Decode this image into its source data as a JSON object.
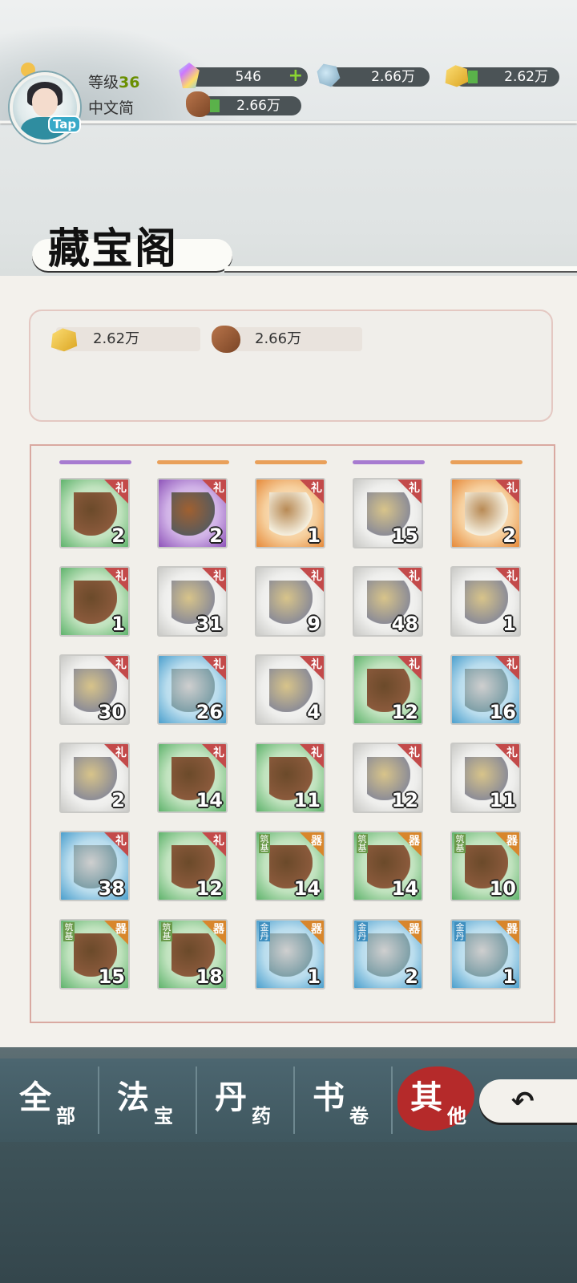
{
  "header": {
    "level_label": "等级",
    "level_value": "36",
    "language": "中文简",
    "avatar_badge": "Tap",
    "resources": {
      "spirit_gem": {
        "value": "546",
        "icon": "rainbow-gem-icon",
        "plus": "+"
      },
      "ore": {
        "value": "2.66万",
        "icon": "blue-ore-icon"
      },
      "gold": {
        "value": "2.62万",
        "icon": "gold-ore-icon"
      },
      "wood": {
        "value": "2.66万",
        "icon": "wood-log-icon"
      }
    }
  },
  "title": "藏宝阁",
  "currency_panel": {
    "gold": {
      "value": "2.62万",
      "icon": "gold-ore-icon"
    },
    "wood": {
      "value": "2.66万",
      "icon": "wood-log-icon"
    }
  },
  "inventory": {
    "tag_gift": "礼",
    "tag_tool": "器",
    "rows": [
      [
        {
          "icon": "stir-fry-dish-icon",
          "count": "2",
          "rarity": "green",
          "tag": "礼"
        },
        {
          "icon": "wok-dish-icon",
          "count": "2",
          "rarity": "purple",
          "tag": "礼"
        },
        {
          "icon": "soup-bowl-icon",
          "count": "1",
          "rarity": "orange",
          "tag": "礼"
        },
        {
          "icon": "iron-ore-icon",
          "count": "15",
          "rarity": "white",
          "tag": "礼"
        },
        {
          "icon": "opal-stone-icon",
          "count": "2",
          "rarity": "orange",
          "tag": "礼"
        }
      ],
      [
        {
          "icon": "book-box-icon",
          "count": "1",
          "rarity": "green",
          "tag": "礼"
        },
        {
          "icon": "jade-pendant-icon",
          "count": "31",
          "rarity": "white",
          "tag": "礼"
        },
        {
          "icon": "jade-dragon-icon",
          "count": "9",
          "rarity": "white",
          "tag": "礼"
        },
        {
          "icon": "ivory-horn-icon",
          "count": "48",
          "rarity": "white",
          "tag": "礼"
        },
        {
          "icon": "incense-burner-icon",
          "count": "1",
          "rarity": "white",
          "tag": "礼"
        }
      ],
      [
        {
          "icon": "green-robe-icon",
          "count": "30",
          "rarity": "white",
          "tag": "礼"
        },
        {
          "icon": "candied-haws-icon",
          "count": "26",
          "rarity": "blue",
          "tag": "礼"
        },
        {
          "icon": "pancake-icon",
          "count": "4",
          "rarity": "white",
          "tag": "礼"
        },
        {
          "icon": "stone-mortar-icon",
          "count": "12",
          "rarity": "green",
          "tag": "礼"
        },
        {
          "icon": "pipa-lute-icon",
          "count": "16",
          "rarity": "blue",
          "tag": "礼"
        }
      ],
      [
        {
          "icon": "flower-jar-icon",
          "count": "2",
          "rarity": "white",
          "tag": "礼"
        },
        {
          "icon": "rabbit-bun-icon",
          "count": "14",
          "rarity": "green",
          "tag": "礼"
        },
        {
          "icon": "hand-mirror-icon",
          "count": "11",
          "rarity": "green",
          "tag": "礼"
        },
        {
          "icon": "hairpin-icon",
          "count": "12",
          "rarity": "white",
          "tag": "礼"
        },
        {
          "icon": "purple-cloak-icon",
          "count": "11",
          "rarity": "white",
          "tag": "礼"
        }
      ],
      [
        {
          "icon": "jade-ring-icon",
          "count": "38",
          "rarity": "blue",
          "tag": "礼"
        },
        {
          "icon": "feather-fan-icon",
          "count": "12",
          "rarity": "green",
          "tag": "礼"
        },
        {
          "icon": "red-crystal-icon",
          "count": "14",
          "rarity": "green",
          "tag": "器",
          "ltag": "筑基"
        },
        {
          "icon": "teal-crystal-icon",
          "count": "14",
          "rarity": "green",
          "tag": "器",
          "ltag": "筑基"
        },
        {
          "icon": "bone-claw-icon",
          "count": "10",
          "rarity": "green",
          "tag": "器",
          "ltag": "筑基"
        }
      ],
      [
        {
          "icon": "blue-orb-icon",
          "count": "15",
          "rarity": "green",
          "tag": "器",
          "ltag": "筑基"
        },
        {
          "icon": "bone-spine-icon",
          "count": "18",
          "rarity": "green",
          "tag": "器",
          "ltag": "筑基"
        },
        {
          "icon": "grey-stone-icon",
          "count": "1",
          "rarity": "blue",
          "tag": "器",
          "ltag": "金丹"
        },
        {
          "icon": "rock-chunk-icon",
          "count": "2",
          "rarity": "blue",
          "tag": "器",
          "ltag": "金丹"
        },
        {
          "icon": "bone-icon",
          "count": "1",
          "rarity": "blue",
          "tag": "器",
          "ltag": "金丹"
        }
      ]
    ]
  },
  "tabs": [
    {
      "big": "全",
      "small": "部",
      "active": false
    },
    {
      "big": "法",
      "small": "宝",
      "active": false
    },
    {
      "big": "丹",
      "small": "药",
      "active": false
    },
    {
      "big": "书",
      "small": "卷",
      "active": false
    },
    {
      "big": "其",
      "small": "他",
      "active": true
    }
  ],
  "back_button": {
    "icon": "back-arrow-icon"
  },
  "colors": {
    "gift_tag": "#c34a4a",
    "active_tab": "#b52a2a",
    "level_value": "#6a8f00"
  }
}
